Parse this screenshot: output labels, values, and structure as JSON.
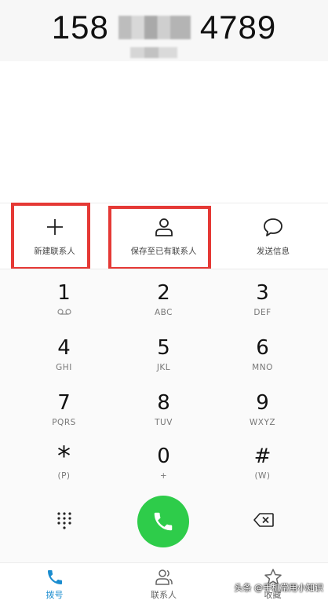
{
  "dialer": {
    "number_prefix": "158",
    "number_suffix": "4789"
  },
  "actions": {
    "new_contact": "新建联系人",
    "save_existing": "保存至已有联系人",
    "send_message": "发送信息"
  },
  "keypad": {
    "keys": [
      {
        "digit": "1",
        "letters": ""
      },
      {
        "digit": "2",
        "letters": "ABC"
      },
      {
        "digit": "3",
        "letters": "DEF"
      },
      {
        "digit": "4",
        "letters": "GHI"
      },
      {
        "digit": "5",
        "letters": "JKL"
      },
      {
        "digit": "6",
        "letters": "MNO"
      },
      {
        "digit": "7",
        "letters": "PQRS"
      },
      {
        "digit": "8",
        "letters": "TUV"
      },
      {
        "digit": "9",
        "letters": "WXYZ"
      },
      {
        "digit": "*",
        "letters": "(P)"
      },
      {
        "digit": "0",
        "letters": "+"
      },
      {
        "digit": "#",
        "letters": "(W)"
      }
    ]
  },
  "colors": {
    "highlight": "#e53935",
    "call_button": "#2ecc4a",
    "active_tab": "#1a8ccf"
  },
  "tabs": {
    "dial": "拨号",
    "contacts": "联系人",
    "favorites": "收藏"
  },
  "watermark": "头条 @手机常用小知识"
}
